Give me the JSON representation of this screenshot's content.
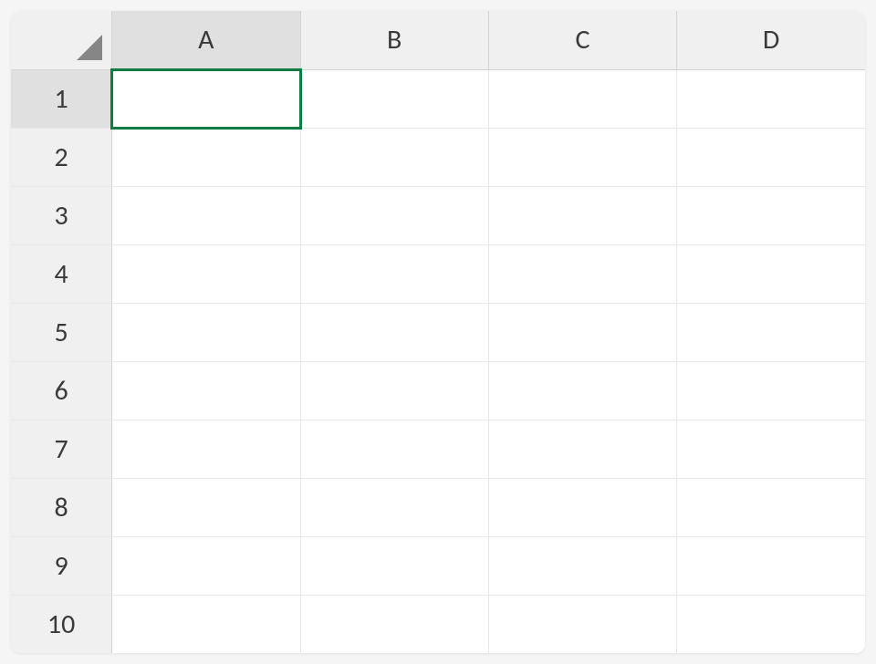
{
  "spreadsheet": {
    "columns": [
      "A",
      "B",
      "C",
      "D"
    ],
    "rows": [
      "1",
      "2",
      "3",
      "4",
      "5",
      "6",
      "7",
      "8",
      "9",
      "10"
    ],
    "active_cell": {
      "col": "A",
      "row": "1"
    },
    "cells": {}
  }
}
